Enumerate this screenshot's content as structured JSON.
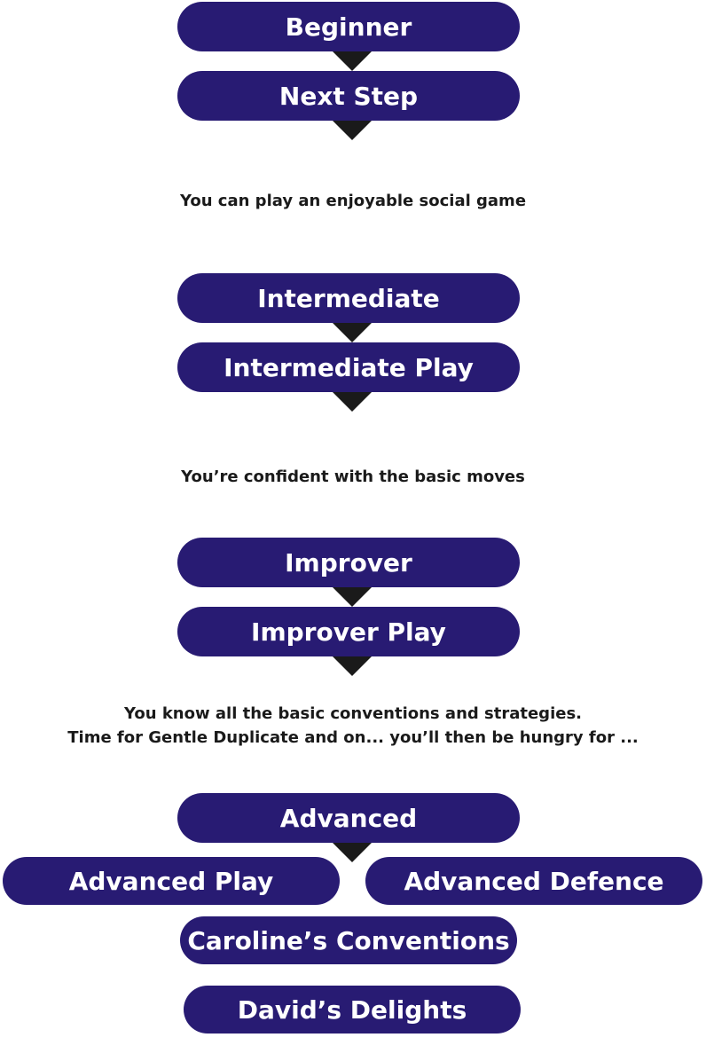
{
  "levels": {
    "beginner": {
      "title": "Beginner",
      "course": "Next Step",
      "caption": "You can play an enjoyable social game"
    },
    "intermediate": {
      "title": "Intermediate",
      "course": "Intermediate Play",
      "caption": "You’re confident with the basic moves"
    },
    "improver": {
      "title": "Improver",
      "course": "Improver Play",
      "caption_line1": "You know all the basic conventions and strategies.",
      "caption_line2": "Time for Gentle Duplicate and on... you’ll then be hungry for ..."
    },
    "advanced": {
      "title": "Advanced",
      "course_play": "Advanced Play",
      "course_defence": "Advanced Defence",
      "course_conventions": "Caroline’s Conventions",
      "course_delights": "David’s Delights"
    }
  },
  "colors": {
    "pill": "#281b73",
    "arrow": "#1a1a1a",
    "text": "#1a1a1a"
  }
}
